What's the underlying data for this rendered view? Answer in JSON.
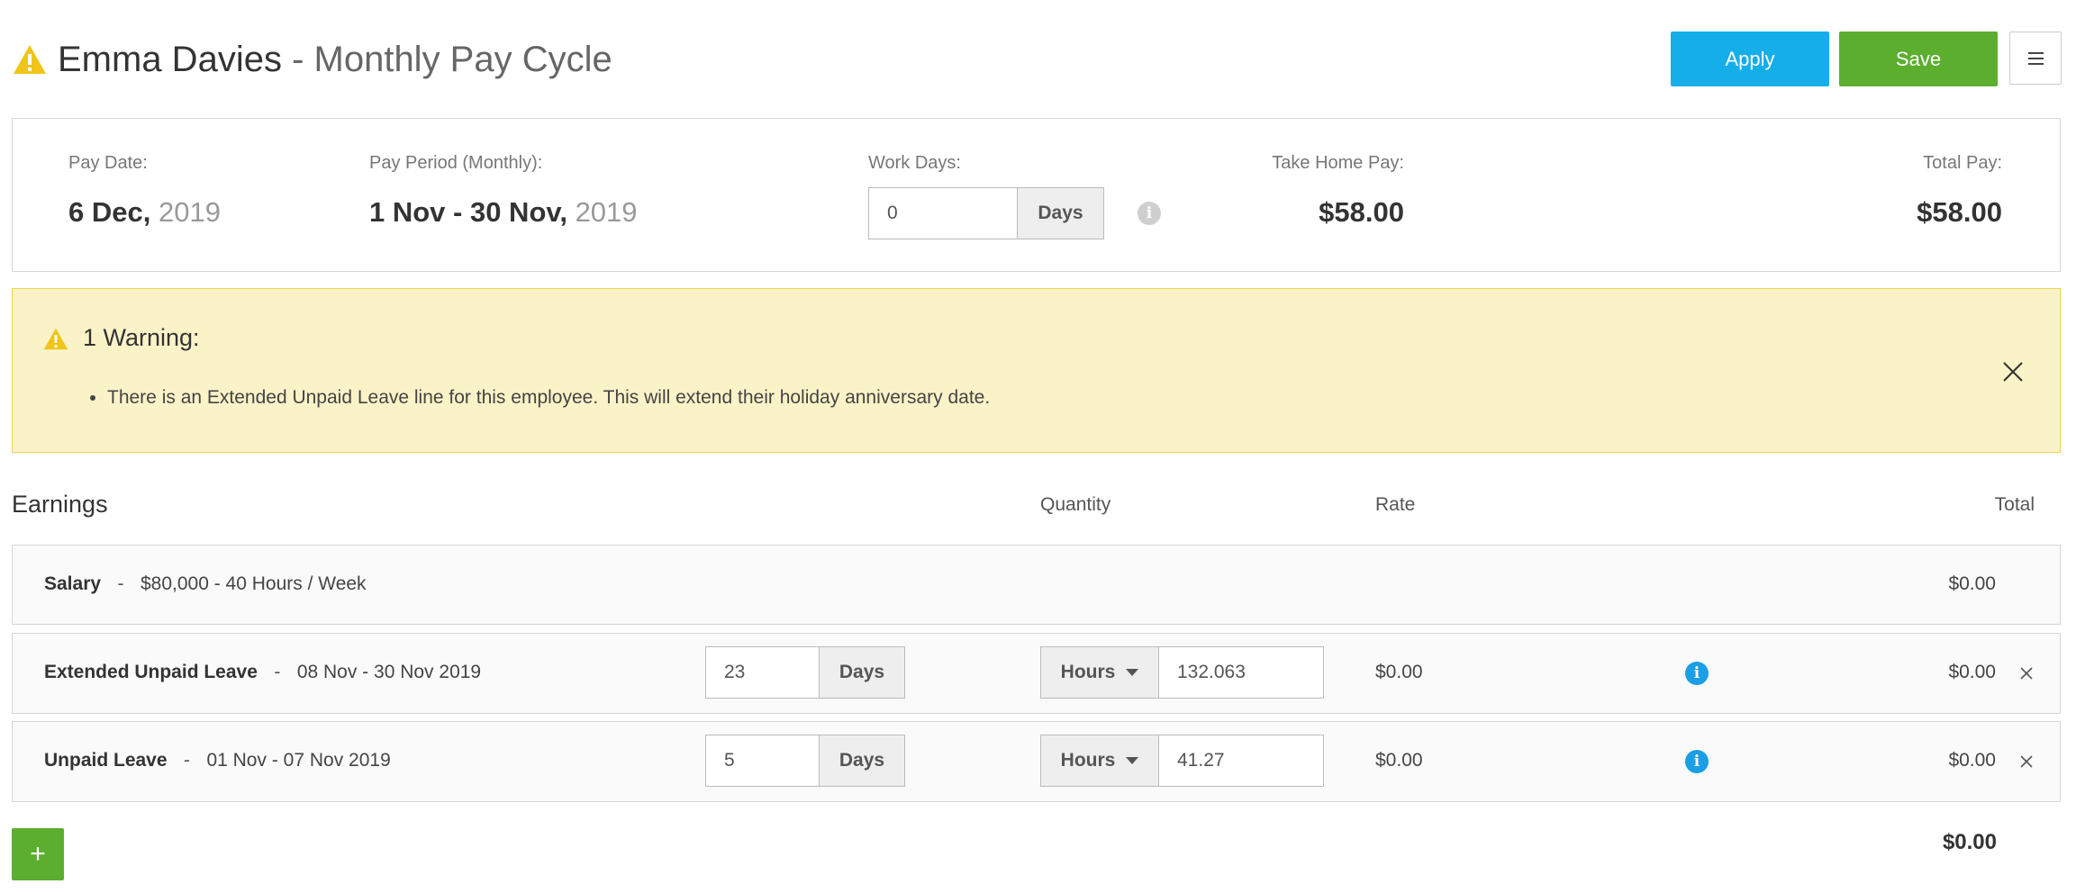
{
  "header": {
    "employee_name": "Emma Davies",
    "subtitle": "- Monthly Pay Cycle",
    "apply_label": "Apply",
    "save_label": "Save"
  },
  "summary": {
    "pay_date_label": "Pay Date:",
    "pay_date_day": "6 Dec,",
    "pay_date_year": "2019",
    "pay_period_label": "Pay Period (Monthly):",
    "pay_period_range": "1 Nov - 30 Nov,",
    "pay_period_year": "2019",
    "work_days_label": "Work Days:",
    "work_days_value": "0",
    "work_days_unit": "Days",
    "take_home_label": "Take Home Pay:",
    "take_home_value": "$58.00",
    "total_pay_label": "Total Pay:",
    "total_pay_value": "$58.00"
  },
  "warning": {
    "title": "1 Warning:",
    "items": [
      "There is an Extended Unpaid Leave line for this employee. This will extend their holiday anniversary date."
    ]
  },
  "earnings": {
    "title": "Earnings",
    "columns": {
      "quantity": "Quantity",
      "rate": "Rate",
      "total": "Total"
    },
    "rows": [
      {
        "name": "Salary",
        "sep": "-",
        "description": "$80,000 - 40 Hours / Week",
        "total": "$0.00"
      },
      {
        "name": "Extended Unpaid Leave",
        "sep": "-",
        "description": "08 Nov - 30 Nov 2019",
        "days": "23",
        "days_unit": "Days",
        "qty_unit": "Hours",
        "quantity": "132.063",
        "rate": "$0.00",
        "total": "$0.00"
      },
      {
        "name": "Unpaid Leave",
        "sep": "-",
        "description": "01 Nov - 07 Nov 2019",
        "days": "5",
        "days_unit": "Days",
        "qty_unit": "Hours",
        "quantity": "41.27",
        "rate": "$0.00",
        "total": "$0.00"
      }
    ],
    "add_label": "+",
    "grand_total": "$0.00"
  },
  "colors": {
    "apply": "#16aee8",
    "save": "#5cae2f",
    "warning_bg": "#fbf3c8",
    "warning_icon": "#f0c419",
    "info_icon": "#1a9ee5"
  }
}
